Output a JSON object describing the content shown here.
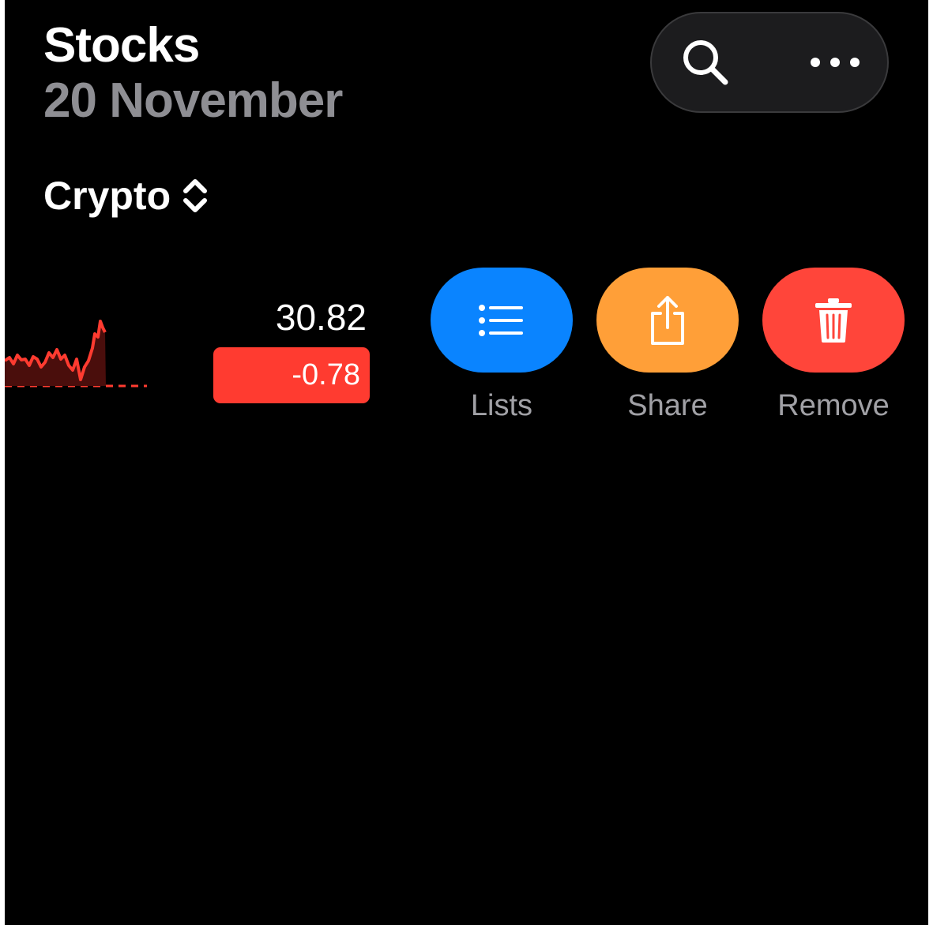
{
  "header": {
    "title": "Stocks",
    "date": "20 November"
  },
  "toolbar": {
    "search_icon": "search-icon",
    "more_icon": "ellipsis-icon"
  },
  "watchlist": {
    "name": "Crypto",
    "selector_icon": "chevron-up-down-icon"
  },
  "row": {
    "price": "30.82",
    "change": "-0.78",
    "change_color": "#ff3b30",
    "sparkline_color": "#ff3b30"
  },
  "swipe_actions": [
    {
      "label": "Lists",
      "icon": "list-icon",
      "color": "#0a84ff"
    },
    {
      "label": "Share",
      "icon": "share-icon",
      "color": "#ff9f38"
    },
    {
      "label": "Remove",
      "icon": "trash-icon",
      "color": "#ff453a"
    }
  ]
}
